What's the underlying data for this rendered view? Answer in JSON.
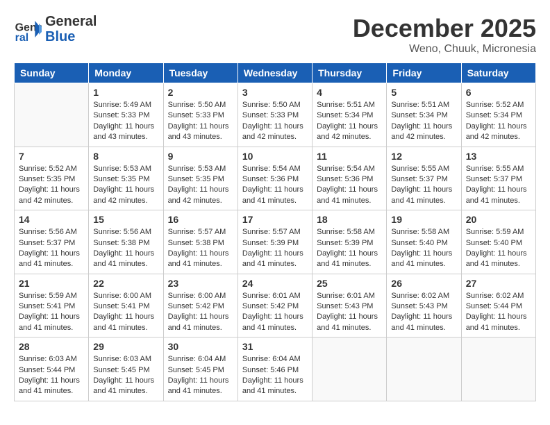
{
  "header": {
    "logo_line1": "General",
    "logo_line2": "Blue",
    "month": "December 2025",
    "location": "Weno, Chuuk, Micronesia"
  },
  "days_of_week": [
    "Sunday",
    "Monday",
    "Tuesday",
    "Wednesday",
    "Thursday",
    "Friday",
    "Saturday"
  ],
  "weeks": [
    [
      {
        "day": "",
        "info": ""
      },
      {
        "day": "1",
        "info": "Sunrise: 5:49 AM\nSunset: 5:33 PM\nDaylight: 11 hours\nand 43 minutes."
      },
      {
        "day": "2",
        "info": "Sunrise: 5:50 AM\nSunset: 5:33 PM\nDaylight: 11 hours\nand 43 minutes."
      },
      {
        "day": "3",
        "info": "Sunrise: 5:50 AM\nSunset: 5:33 PM\nDaylight: 11 hours\nand 42 minutes."
      },
      {
        "day": "4",
        "info": "Sunrise: 5:51 AM\nSunset: 5:34 PM\nDaylight: 11 hours\nand 42 minutes."
      },
      {
        "day": "5",
        "info": "Sunrise: 5:51 AM\nSunset: 5:34 PM\nDaylight: 11 hours\nand 42 minutes."
      },
      {
        "day": "6",
        "info": "Sunrise: 5:52 AM\nSunset: 5:34 PM\nDaylight: 11 hours\nand 42 minutes."
      }
    ],
    [
      {
        "day": "7",
        "info": "Sunrise: 5:52 AM\nSunset: 5:35 PM\nDaylight: 11 hours\nand 42 minutes."
      },
      {
        "day": "8",
        "info": "Sunrise: 5:53 AM\nSunset: 5:35 PM\nDaylight: 11 hours\nand 42 minutes."
      },
      {
        "day": "9",
        "info": "Sunrise: 5:53 AM\nSunset: 5:35 PM\nDaylight: 11 hours\nand 42 minutes."
      },
      {
        "day": "10",
        "info": "Sunrise: 5:54 AM\nSunset: 5:36 PM\nDaylight: 11 hours\nand 41 minutes."
      },
      {
        "day": "11",
        "info": "Sunrise: 5:54 AM\nSunset: 5:36 PM\nDaylight: 11 hours\nand 41 minutes."
      },
      {
        "day": "12",
        "info": "Sunrise: 5:55 AM\nSunset: 5:37 PM\nDaylight: 11 hours\nand 41 minutes."
      },
      {
        "day": "13",
        "info": "Sunrise: 5:55 AM\nSunset: 5:37 PM\nDaylight: 11 hours\nand 41 minutes."
      }
    ],
    [
      {
        "day": "14",
        "info": "Sunrise: 5:56 AM\nSunset: 5:37 PM\nDaylight: 11 hours\nand 41 minutes."
      },
      {
        "day": "15",
        "info": "Sunrise: 5:56 AM\nSunset: 5:38 PM\nDaylight: 11 hours\nand 41 minutes."
      },
      {
        "day": "16",
        "info": "Sunrise: 5:57 AM\nSunset: 5:38 PM\nDaylight: 11 hours\nand 41 minutes."
      },
      {
        "day": "17",
        "info": "Sunrise: 5:57 AM\nSunset: 5:39 PM\nDaylight: 11 hours\nand 41 minutes."
      },
      {
        "day": "18",
        "info": "Sunrise: 5:58 AM\nSunset: 5:39 PM\nDaylight: 11 hours\nand 41 minutes."
      },
      {
        "day": "19",
        "info": "Sunrise: 5:58 AM\nSunset: 5:40 PM\nDaylight: 11 hours\nand 41 minutes."
      },
      {
        "day": "20",
        "info": "Sunrise: 5:59 AM\nSunset: 5:40 PM\nDaylight: 11 hours\nand 41 minutes."
      }
    ],
    [
      {
        "day": "21",
        "info": "Sunrise: 5:59 AM\nSunset: 5:41 PM\nDaylight: 11 hours\nand 41 minutes."
      },
      {
        "day": "22",
        "info": "Sunrise: 6:00 AM\nSunset: 5:41 PM\nDaylight: 11 hours\nand 41 minutes."
      },
      {
        "day": "23",
        "info": "Sunrise: 6:00 AM\nSunset: 5:42 PM\nDaylight: 11 hours\nand 41 minutes."
      },
      {
        "day": "24",
        "info": "Sunrise: 6:01 AM\nSunset: 5:42 PM\nDaylight: 11 hours\nand 41 minutes."
      },
      {
        "day": "25",
        "info": "Sunrise: 6:01 AM\nSunset: 5:43 PM\nDaylight: 11 hours\nand 41 minutes."
      },
      {
        "day": "26",
        "info": "Sunrise: 6:02 AM\nSunset: 5:43 PM\nDaylight: 11 hours\nand 41 minutes."
      },
      {
        "day": "27",
        "info": "Sunrise: 6:02 AM\nSunset: 5:44 PM\nDaylight: 11 hours\nand 41 minutes."
      }
    ],
    [
      {
        "day": "28",
        "info": "Sunrise: 6:03 AM\nSunset: 5:44 PM\nDaylight: 11 hours\nand 41 minutes."
      },
      {
        "day": "29",
        "info": "Sunrise: 6:03 AM\nSunset: 5:45 PM\nDaylight: 11 hours\nand 41 minutes."
      },
      {
        "day": "30",
        "info": "Sunrise: 6:04 AM\nSunset: 5:45 PM\nDaylight: 11 hours\nand 41 minutes."
      },
      {
        "day": "31",
        "info": "Sunrise: 6:04 AM\nSunset: 5:46 PM\nDaylight: 11 hours\nand 41 minutes."
      },
      {
        "day": "",
        "info": ""
      },
      {
        "day": "",
        "info": ""
      },
      {
        "day": "",
        "info": ""
      }
    ]
  ]
}
